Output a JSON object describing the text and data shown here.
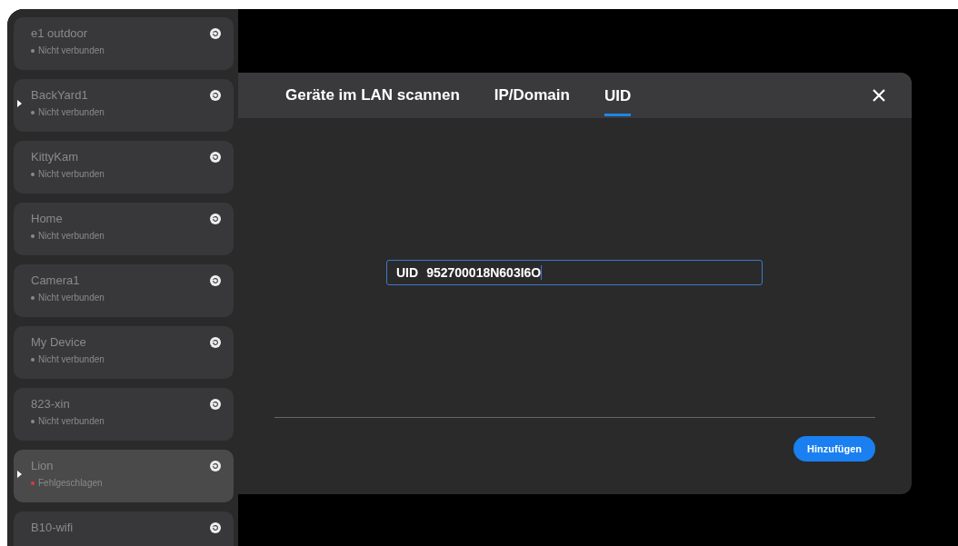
{
  "devices": [
    {
      "name": "e1 outdoor",
      "status": "Nicht verbunden",
      "color": "#8a8a8a",
      "marked": false,
      "selected": false
    },
    {
      "name": "BackYard1",
      "status": "Nicht verbunden",
      "color": "#8a8a8a",
      "marked": true,
      "selected": false
    },
    {
      "name": "KittyKam",
      "status": "Nicht verbunden",
      "color": "#8a8a8a",
      "marked": false,
      "selected": false
    },
    {
      "name": "Home",
      "status": "Nicht verbunden",
      "color": "#8a8a8a",
      "marked": false,
      "selected": false
    },
    {
      "name": "Camera1",
      "status": "Nicht verbunden",
      "color": "#8a8a8a",
      "marked": false,
      "selected": false
    },
    {
      "name": "My Device",
      "status": "Nicht verbunden",
      "color": "#8a8a8a",
      "marked": false,
      "selected": false
    },
    {
      "name": "823-xin",
      "status": "Nicht verbunden",
      "color": "#8a8a8a",
      "marked": false,
      "selected": false
    },
    {
      "name": "Lion",
      "status": "Fehlgeschlagen",
      "color": "#e53935",
      "marked": true,
      "selected": true
    },
    {
      "name": "B10-wifi",
      "marked": false,
      "selected": false
    }
  ],
  "dialog": {
    "tabs": [
      {
        "label": "Geräte im LAN scannen",
        "selected": false
      },
      {
        "label": "IP/Domain",
        "selected": false
      },
      {
        "label": "UID",
        "selected": true
      }
    ],
    "uid_field": {
      "label": "UID",
      "value": "952700018N603I6O"
    },
    "add_button": "Hinzufügen"
  }
}
